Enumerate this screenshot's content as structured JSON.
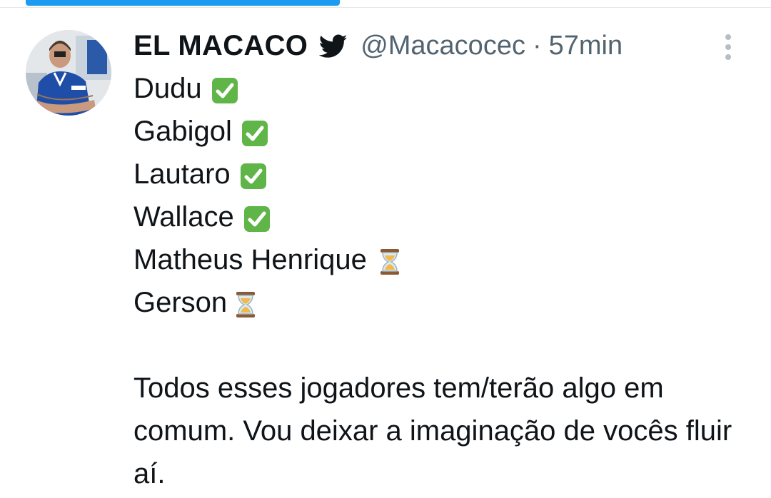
{
  "tweet": {
    "display_name": "EL MACACO",
    "handle": "@Macacocec",
    "separator": "·",
    "time": "57min",
    "lines": [
      {
        "text": "Dudu",
        "status_icon": "check-mark-button-icon"
      },
      {
        "text": "Gabigol",
        "status_icon": "check-mark-button-icon"
      },
      {
        "text": "Lautaro",
        "status_icon": "check-mark-button-icon"
      },
      {
        "text": "Wallace",
        "status_icon": "check-mark-button-icon"
      },
      {
        "text": "Matheus Henrique",
        "status_icon": "hourglass-icon"
      },
      {
        "text": "Gerson",
        "status_icon": "hourglass-icon"
      }
    ],
    "paragraph": "Todos esses jogadores tem/terão algo em comum. Vou deixar a imaginação de vocês fluir aí."
  },
  "icons": {
    "verified": "twitter-bird-icon",
    "more": "vertical-ellipsis-icon"
  },
  "colors": {
    "accent": "#1d9bf0",
    "text": "#0f1419",
    "secondary": "#536471",
    "check_green": "#5fb548"
  }
}
